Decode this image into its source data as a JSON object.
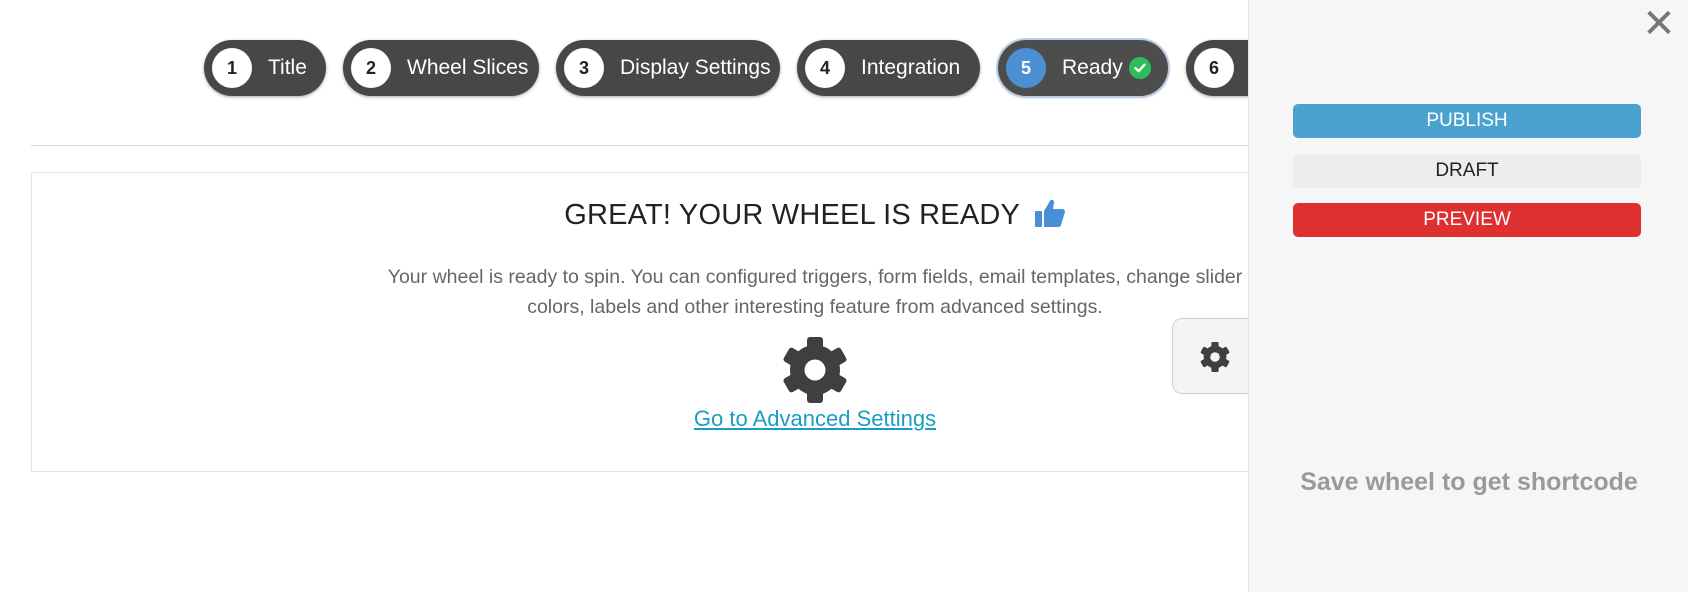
{
  "steps": [
    {
      "number": "1",
      "label": "Title"
    },
    {
      "number": "2",
      "label": "Wheel Slices"
    },
    {
      "number": "3",
      "label": "Display Settings"
    },
    {
      "number": "4",
      "label": "Integration"
    },
    {
      "number": "5",
      "label": "Ready",
      "active": true,
      "icon": "check-circle-icon"
    },
    {
      "number": "6",
      "label": ""
    }
  ],
  "main": {
    "heading": "GREAT! YOUR WHEEL IS READY",
    "heading_icon": "thumbs-up-icon",
    "description_line1": "Your wheel is ready to spin. You can configured triggers, form fields, email templates, change slider",
    "description_line2": "colors, labels and other interesting feature from advanced settings.",
    "gear_icon": "gear-icon",
    "advanced_link": "Go to Advanced Settings"
  },
  "sidebar": {
    "close_icon": "close-icon",
    "close_glyph": "✕",
    "publish_label": "PUBLISH",
    "draft_label": "DRAFT",
    "preview_label": "PREVIEW",
    "shortcode_message": "Save wheel to get shortcode"
  },
  "colors": {
    "step_bg": "#474747",
    "active_step_accent": "#4a90d2",
    "publish": "#4aa3ce",
    "preview": "#de3030",
    "link": "#1a9dc4",
    "check": "#2ebd59"
  }
}
